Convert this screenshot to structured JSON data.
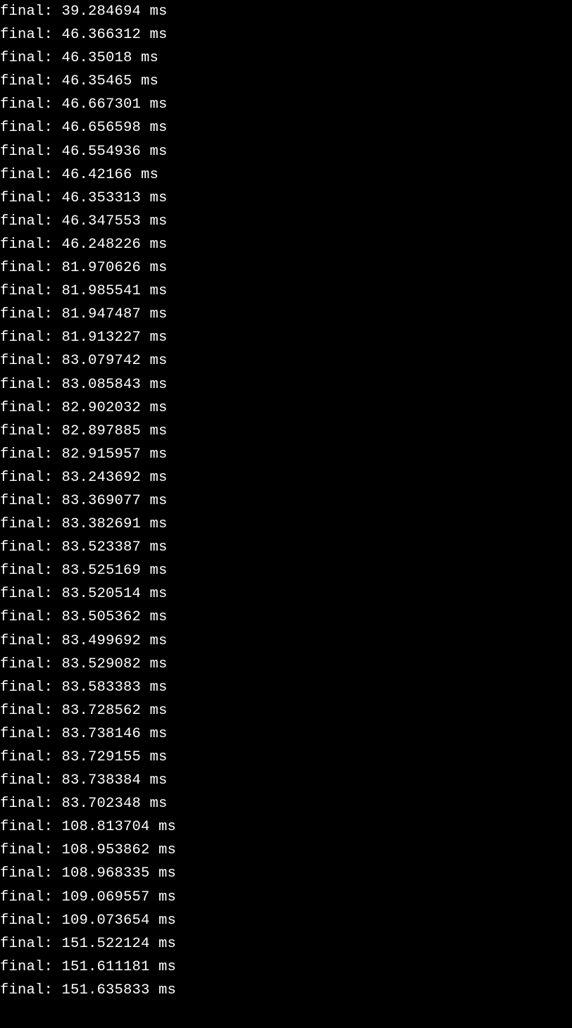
{
  "terminal": {
    "label": "final:",
    "unit": "ms",
    "lines": [
      "39.284694",
      "46.366312",
      "46.35018",
      "46.35465",
      "46.667301",
      "46.656598",
      "46.554936",
      "46.42166",
      "46.353313",
      "46.347553",
      "46.248226",
      "81.970626",
      "81.985541",
      "81.947487",
      "81.913227",
      "83.079742",
      "83.085843",
      "82.902032",
      "82.897885",
      "82.915957",
      "83.243692",
      "83.369077",
      "83.382691",
      "83.523387",
      "83.525169",
      "83.520514",
      "83.505362",
      "83.499692",
      "83.529082",
      "83.583383",
      "83.728562",
      "83.738146",
      "83.729155",
      "83.738384",
      "83.702348",
      "108.813704",
      "108.953862",
      "108.968335",
      "109.069557",
      "109.073654",
      "151.522124",
      "151.611181",
      "151.635833"
    ]
  }
}
